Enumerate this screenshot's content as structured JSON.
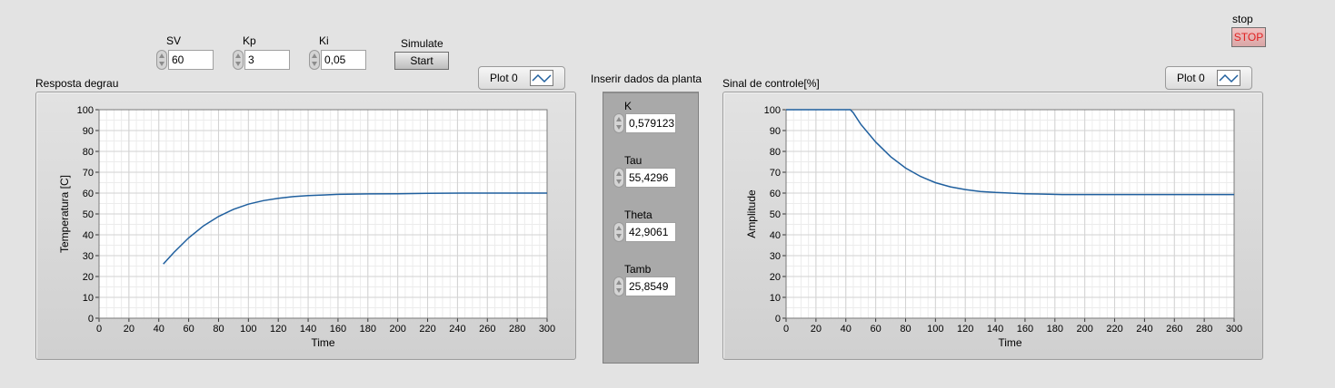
{
  "controls": {
    "sv": {
      "label": "SV",
      "value": "60"
    },
    "kp": {
      "label": "Kp",
      "value": "3"
    },
    "ki": {
      "label": "Ki",
      "value": "0,05"
    },
    "simulate": {
      "label": "Simulate",
      "button": "Start"
    },
    "stop": {
      "label": "stop",
      "button": "STOP"
    }
  },
  "planta": {
    "title": "Inserir dados da planta",
    "fields": [
      {
        "label": "K",
        "value": "0,579123"
      },
      {
        "label": "Tau",
        "value": "55,4296"
      },
      {
        "label": "Theta",
        "value": "42,9061"
      },
      {
        "label": "Tamb",
        "value": "25,8549"
      }
    ]
  },
  "colors": {
    "trace": "#1f5f9e",
    "background": "#e3e3e3",
    "stop_text": "#e02020"
  },
  "charts": [
    {
      "title": "Resposta degrau",
      "legend": "Plot 0",
      "legend_icon": "line-icon"
    },
    {
      "title": "Sinal de controle[%]",
      "legend": "Plot 0",
      "legend_icon": "line-icon"
    }
  ],
  "chart_data": [
    {
      "type": "line",
      "title": "Resposta degrau",
      "xlabel": "Time",
      "ylabel": "Temperatura [C]",
      "xlim": [
        0,
        300
      ],
      "ylim": [
        0,
        100
      ],
      "xticks": [
        0,
        20,
        40,
        60,
        80,
        100,
        120,
        140,
        160,
        180,
        200,
        220,
        240,
        260,
        280,
        300
      ],
      "yticks": [
        0,
        10,
        20,
        30,
        40,
        50,
        60,
        70,
        80,
        90,
        100
      ],
      "grid": true,
      "series": [
        {
          "x": [
            43,
            50,
            60,
            70,
            80,
            90,
            100,
            110,
            120,
            130,
            140,
            150,
            160,
            180,
            200,
            220,
            250,
            300
          ],
          "y": [
            26,
            31.5,
            38.5,
            44.3,
            48.8,
            52.2,
            54.7,
            56.4,
            57.5,
            58.3,
            58.8,
            59.1,
            59.4,
            59.6,
            59.7,
            59.9,
            60,
            60
          ]
        }
      ]
    },
    {
      "type": "line",
      "title": "Sinal de controle[%]",
      "xlabel": "Time",
      "ylabel": "Amplitude",
      "xlim": [
        0,
        300
      ],
      "ylim": [
        0,
        100
      ],
      "xticks": [
        0,
        20,
        40,
        60,
        80,
        100,
        120,
        140,
        160,
        180,
        200,
        220,
        240,
        260,
        280,
        300
      ],
      "yticks": [
        0,
        10,
        20,
        30,
        40,
        50,
        60,
        70,
        80,
        90,
        100
      ],
      "grid": true,
      "series": [
        {
          "x": [
            0,
            43,
            45,
            50,
            60,
            70,
            80,
            90,
            100,
            110,
            120,
            130,
            140,
            150,
            160,
            185,
            200,
            250,
            300
          ],
          "y": [
            100,
            100,
            98.5,
            93,
            84.5,
            77.5,
            72,
            68,
            65,
            63,
            61.7,
            60.8,
            60.3,
            60,
            59.7,
            59.3,
            59.3,
            59.3,
            59.3
          ]
        }
      ]
    }
  ]
}
